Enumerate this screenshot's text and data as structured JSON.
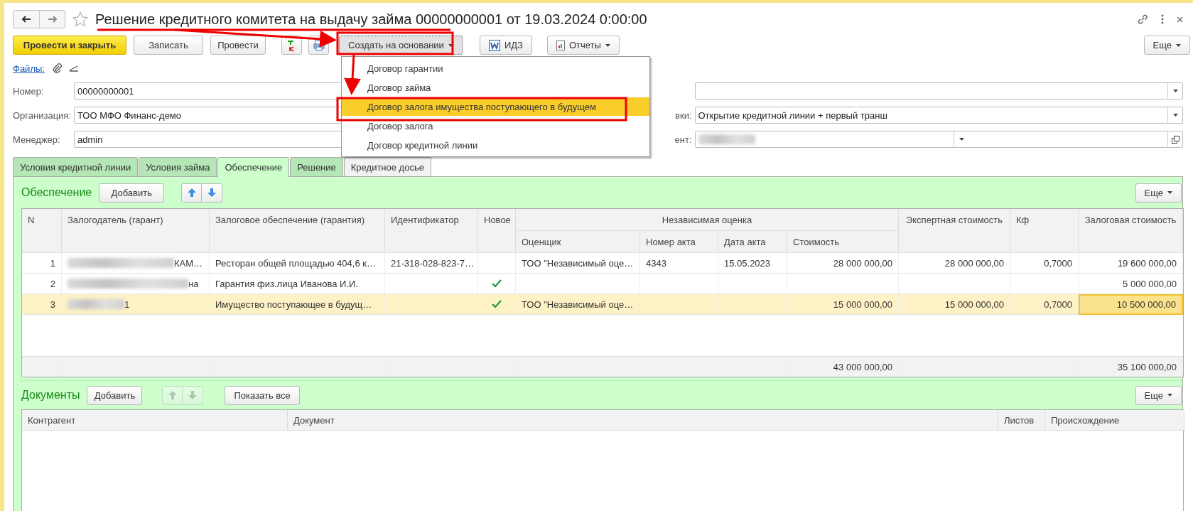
{
  "window": {
    "title": "Решение кредитного комитета на выдачу займа 00000000001 от 19.03.2024 0:00:00",
    "favorite": false
  },
  "toolbar": {
    "buttons": [
      {
        "kind": "primary",
        "label": "Провести и закрыть"
      },
      {
        "kind": "plain",
        "label": "Записать"
      },
      {
        "kind": "plain",
        "label": "Провести"
      },
      {
        "kind": "ledger"
      },
      {
        "kind": "print"
      },
      {
        "kind": "menu",
        "label": "Создать на основании",
        "expanded": true
      },
      {
        "kind": "word",
        "label": "ИДЗ"
      },
      {
        "kind": "report",
        "label": "Отчеты"
      }
    ],
    "more": "Еще"
  },
  "files_link": "Файлы:",
  "fields_left": [
    {
      "label": "Номер:",
      "value": "00000000001"
    },
    {
      "label": "Организация:",
      "value": "ТОО МФО Финанс-демо"
    },
    {
      "label": "Менеджер:",
      "value": "admin"
    }
  ],
  "fields_right": [
    {
      "kind": "select"
    },
    {
      "kind": "select",
      "label": "вки:",
      "value": "Открытие кредитной линии + первый транш"
    },
    {
      "kind": "lookup",
      "label": "ент:",
      "redacted": true
    }
  ],
  "tabs": [
    {
      "label": "Условия кредитной линии",
      "selected": false
    },
    {
      "label": "Условия займа",
      "selected": false
    },
    {
      "label": "Обеспечение",
      "selected": true
    },
    {
      "label": "Решение",
      "selected": false
    },
    {
      "label": "Кредитное досье",
      "selected": false
    }
  ],
  "collateral": {
    "title": "Обеспечение",
    "add": "Добавить",
    "more": "Еще",
    "group_header": "Независимая оценка",
    "columns": [
      "N",
      "Залогодатель (гарант)",
      "Залоговое обеспечение (гарантия)",
      "Идентификатор",
      "Новое",
      "Оценщик",
      "Номер акта",
      "Дата акта",
      "Стоимость",
      "Экспертная стоимость",
      "Кф",
      "Залоговая стоимость"
    ],
    "rows": [
      {
        "n": "1",
        "pledger": "КАМ…",
        "pledger_redacted": true,
        "collateral": "Ресторан общей площадью 404,6 к…",
        "identifier": "21-318-028-823-7…",
        "new": false,
        "appraiser": "ТОО \"Независимый оце…",
        "act_number": "4343",
        "act_date": "15.05.2023",
        "cost": "28 000 000,00",
        "expert_cost": "28 000 000,00",
        "coef": "0,7000",
        "pledge_cost": "19 600 000,00",
        "selected": false
      },
      {
        "n": "2",
        "pledger": "на",
        "pledger_redacted": true,
        "collateral": "Гарантия физ.лица Иванова И.И.",
        "new": true,
        "pledge_cost": "5 000 000,00",
        "selected": false
      },
      {
        "n": "3",
        "pledger": "1",
        "pledger_redacted": true,
        "collateral": "Имущество поступающее в будущ…",
        "new": true,
        "appraiser": "ТОО \"Независимый оце…",
        "cost": "15 000 000,00",
        "expert_cost": "15 000 000,00",
        "coef": "0,7000",
        "pledge_cost": "10 500 000,00",
        "selected": true
      }
    ],
    "totals": {
      "cost": "43 000 000,00",
      "pledge_cost": "35 100 000,00"
    }
  },
  "documents": {
    "title": "Документы",
    "add": "Добавить",
    "move_disabled": true,
    "show_all": "Показать все",
    "more": "Еще",
    "columns": [
      "Контрагент",
      "Документ",
      "Листов",
      "Происхождение"
    ]
  },
  "menu": {
    "items": [
      {
        "label": "Договор гарантии",
        "selected": false
      },
      {
        "label": "Договор займа",
        "selected": false
      },
      {
        "label": "Договор залога имущества поступающего в будущем",
        "selected": true
      },
      {
        "label": "Договор залога",
        "selected": false
      },
      {
        "label": "Договор кредитной линии",
        "selected": false
      }
    ]
  }
}
